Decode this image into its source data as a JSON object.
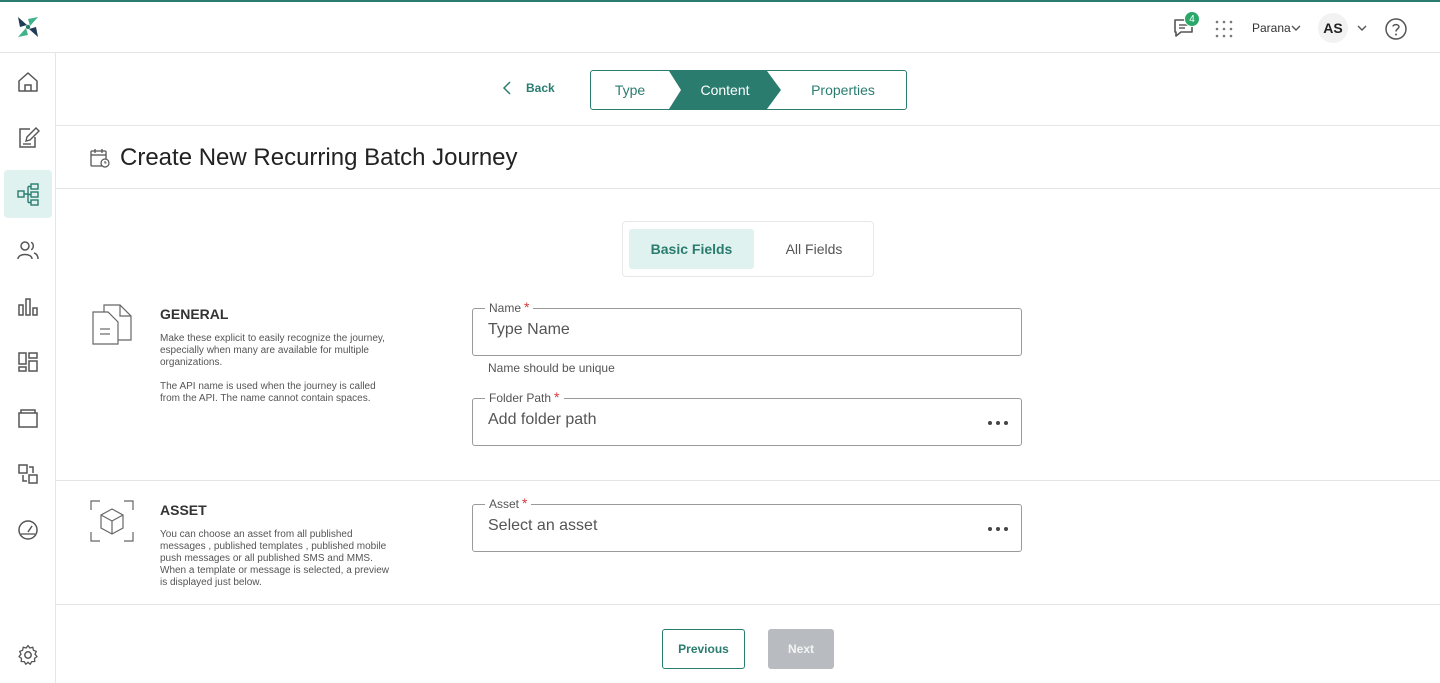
{
  "header": {
    "notification_count": "4",
    "org_name": "Parana",
    "avatar_initials": "AS",
    "icons": [
      "app-logo",
      "chat-icon",
      "apps-grid-icon",
      "chevron-down-icon",
      "help-icon"
    ]
  },
  "sidebar": {
    "items": [
      {
        "name": "home",
        "icon": "home-icon",
        "active": false
      },
      {
        "name": "content",
        "icon": "edit-icon",
        "active": false
      },
      {
        "name": "journeys",
        "icon": "flow-icon",
        "active": true
      },
      {
        "name": "audience",
        "icon": "users-icon",
        "active": false
      },
      {
        "name": "analytics",
        "icon": "bar-chart-icon",
        "active": false
      },
      {
        "name": "dashboards",
        "icon": "dashboard-icon",
        "active": false
      },
      {
        "name": "archive",
        "icon": "archive-icon",
        "active": false
      },
      {
        "name": "integrations",
        "icon": "integration-icon",
        "active": false
      },
      {
        "name": "monitor",
        "icon": "gauge-icon",
        "active": false
      },
      {
        "name": "settings",
        "icon": "gear-icon",
        "active": false
      }
    ]
  },
  "stepper": {
    "back_label": "Back",
    "steps": [
      {
        "label": "Type",
        "active": false
      },
      {
        "label": "Content",
        "active": true
      },
      {
        "label": "Properties",
        "active": false
      }
    ]
  },
  "page": {
    "title": "Create New Recurring Batch Journey"
  },
  "field_toggle": {
    "basic_label": "Basic Fields",
    "all_label": "All Fields",
    "selected": "Basic Fields"
  },
  "general": {
    "title": "GENERAL",
    "desc1": "Make these explicit to easily recognize the journey, especially when many are available for multiple organizations.",
    "desc2": "The API name is used when the journey is called from the API. The name cannot contain spaces.",
    "name_label": "Name",
    "name_placeholder": "Type Name",
    "name_hint": "Name should be unique",
    "folder_label": "Folder Path",
    "folder_placeholder": "Add folder path"
  },
  "asset": {
    "title": "ASSET",
    "desc": "You can choose an asset from all published messages , published templates , published mobile push messages or all published SMS and MMS. When a template or message is selected, a preview is displayed just below.",
    "asset_label": "Asset",
    "asset_placeholder": "Select an asset"
  },
  "footer": {
    "previous_label": "Previous",
    "next_label": "Next"
  },
  "colors": {
    "brand": "#2a7c6f",
    "active_bg": "#dff2ef",
    "required": "#d93838",
    "badge": "#2aa86a",
    "disabled": "#b8bcc0"
  }
}
